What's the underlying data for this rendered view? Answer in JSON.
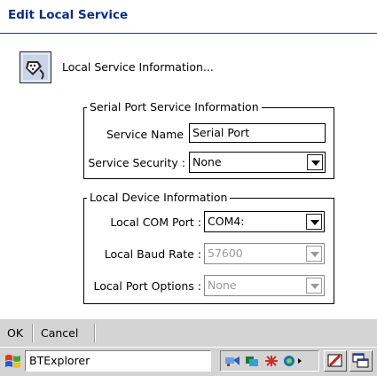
{
  "window": {
    "title": "Edit Local Service"
  },
  "header": {
    "info_text": "Local Service Information...",
    "icon": "serial-cable-icon"
  },
  "serial_group": {
    "legend": "Serial Port Service Information",
    "service_name_label": "Service Name",
    "service_name_value": "Serial Port",
    "security_label": "Service Security :",
    "security_value": "None"
  },
  "device_group": {
    "legend": "Local Device Information",
    "com_port_label": "Local COM Port :",
    "com_port_value": "COM4:",
    "baud_label": "Local Baud Rate :",
    "baud_value": "57600",
    "options_label": "Local Port Options :",
    "options_value": "None"
  },
  "menubar": {
    "ok": "OK",
    "cancel": "Cancel"
  },
  "taskbar": {
    "app_label": "BTExplorer",
    "start_icon": "windows-flag-icon",
    "tray_icons": [
      "bluetooth-explorer-icon",
      "network-icon",
      "bluetooth-icon",
      "volume-icon"
    ]
  },
  "colors": {
    "title": "#0c2a8c",
    "bar": "#d4d4d4",
    "disabled_text": "#9a9a9a"
  }
}
